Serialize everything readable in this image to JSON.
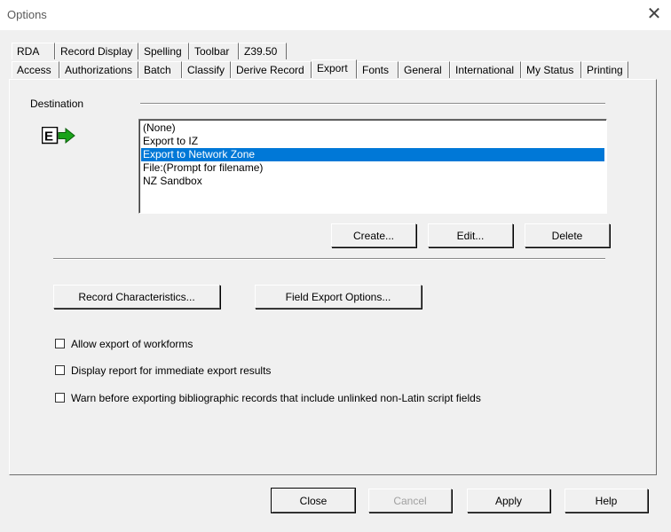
{
  "window": {
    "title": "Options",
    "close_glyph": "✕"
  },
  "tabs": {
    "row1": [
      "RDA",
      "Record Display",
      "Spelling",
      "Toolbar",
      "Z39.50"
    ],
    "row2": [
      "Access",
      "Authorizations",
      "Batch",
      "Classify",
      "Derive Record",
      "Export",
      "Fonts",
      "General",
      "International",
      "My Status",
      "Printing"
    ],
    "active": "Export"
  },
  "destination": {
    "label": "Destination",
    "icon_letter": "E",
    "items": [
      "(None)",
      "Export to IZ",
      "Export to Network Zone",
      "File:(Prompt for filename)",
      "NZ Sandbox"
    ],
    "selected_index": 2
  },
  "dest_buttons": {
    "create": "Create...",
    "edit": "Edit...",
    "delete": "Delete"
  },
  "options_buttons": {
    "record_characteristics": "Record Characteristics...",
    "field_export_options": "Field Export Options..."
  },
  "checkboxes": [
    {
      "label": "Allow export of workforms",
      "checked": false
    },
    {
      "label": "Display report for immediate export results",
      "checked": false
    },
    {
      "label": "Warn before exporting bibliographic records that include unlinked non-Latin script fields",
      "checked": false
    }
  ],
  "footer": {
    "close": "Close",
    "cancel": "Cancel",
    "apply": "Apply",
    "help": "Help"
  },
  "colors": {
    "selection": "#0078d7",
    "icon_arrow": "#1aa31a"
  }
}
